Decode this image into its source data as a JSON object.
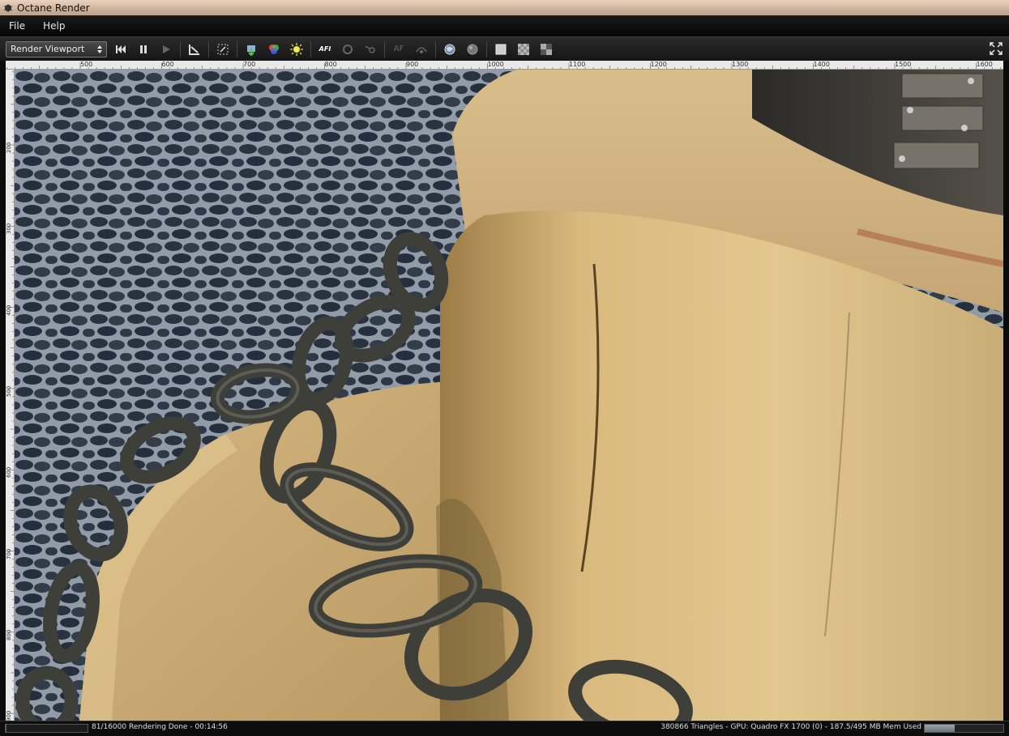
{
  "window": {
    "title": "Octane Render"
  },
  "menu": [
    {
      "label": "File"
    },
    {
      "label": "Help"
    }
  ],
  "toolbar": {
    "viewport_select": "Render Viewport",
    "buttons": [
      "restart-icon",
      "pause-icon",
      "play-icon",
      "region-select-icon",
      "zoom-fit-icon",
      "load-icon",
      "color-picker-icon",
      "light-icon",
      "af-icon",
      "refresh-icon",
      "pick-icon",
      "autofocus-icon",
      "camera-icon",
      "world-icon",
      "material-icon",
      "clay-mode-icon",
      "checker-icon",
      "alpha-icon",
      "fullscreen-icon"
    ],
    "af_label": "AF",
    "afi_label": "AFI"
  },
  "ruler": {
    "horizontal": [
      "500",
      "600",
      "700",
      "800",
      "900",
      "1000",
      "1100",
      "1200",
      "1300",
      "1400",
      "1500",
      "1600"
    ],
    "vertical": [
      "200",
      "300",
      "400",
      "500",
      "600",
      "700",
      "800",
      "900"
    ]
  },
  "status": {
    "progress": 0.005,
    "left": "81/16000 Rendering Done - 00:14:56",
    "right": "380866 Triangles - GPU: Quadro FX 1700 (0) - 187.5/495 MB Mem Used",
    "mem_used_fraction": 0.38
  }
}
